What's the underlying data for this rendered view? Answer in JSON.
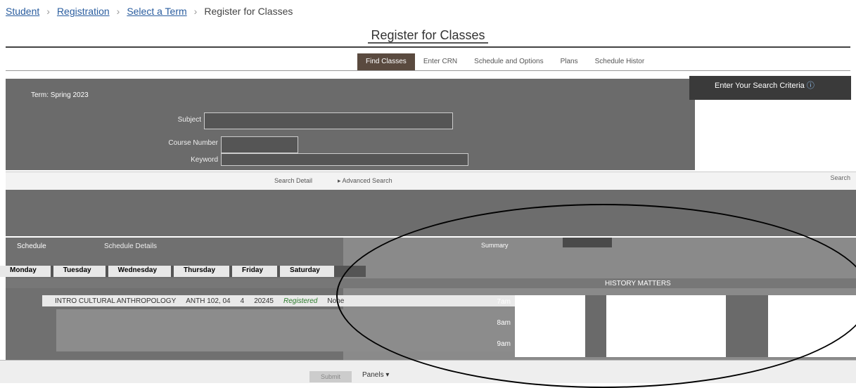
{
  "breadcrumb": {
    "items": [
      "Student",
      "Registration",
      "Select a Term",
      "Register for Classes"
    ]
  },
  "page": {
    "title": "Register for Classes"
  },
  "tabs": {
    "find_classes": "Find Classes",
    "enter_crn": "Enter CRN",
    "schedule_options": "Schedule and Options",
    "plans": "Plans",
    "browse_history": "Schedule Histor"
  },
  "search": {
    "heading": "Enter Your Search Criteria",
    "term": "Term: Spring 2023",
    "subject_label": "Subject",
    "course_number_label": "Course Number",
    "keyword_label": "Keyword",
    "keyword_link": "Search Detail",
    "advanced_link": "Advanced Search",
    "search_button": "Search"
  },
  "schedule": {
    "section_title": "Schedule",
    "details_tab": "Schedule Details",
    "summary_tab": "Summary",
    "days": [
      "Monday",
      "Tuesday",
      "Wednesday",
      "Thursday",
      "Friday",
      "Saturday"
    ],
    "row": {
      "title": "INTRO CULTURAL ANTHROPOLOGY",
      "course": "ANTH 102, 04",
      "hours": "4",
      "crn": "20245",
      "status": "Registered",
      "grading": "None"
    },
    "history_item": "HISTORY MATTERS",
    "times": [
      "7am",
      "8am",
      "9am"
    ]
  },
  "footer": {
    "submit": "Submit",
    "panels": "Panels"
  }
}
